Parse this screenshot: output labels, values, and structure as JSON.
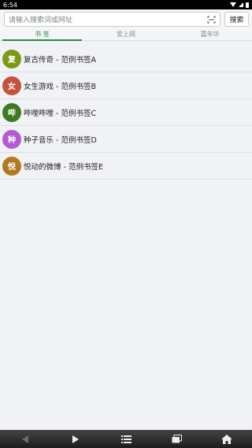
{
  "status_bar": {
    "time": "6:54"
  },
  "search": {
    "placeholder": "请输入搜索词或网址",
    "button_label": "搜索"
  },
  "tabs": [
    {
      "label": "书 签",
      "active": true
    },
    {
      "label": "爱上网",
      "active": false
    },
    {
      "label": "嘉年华",
      "active": false
    }
  ],
  "bookmarks": [
    {
      "avatar": "复",
      "color": "#7d9a16",
      "label": "复古传奇 - 范例书签A"
    },
    {
      "avatar": "女",
      "color": "#c4533b",
      "label": "女生游戏 - 范例书签B"
    },
    {
      "avatar": "哔",
      "color": "#3f7a22",
      "label": "哔哩哔哩 - 范例书签C"
    },
    {
      "avatar": "种",
      "color": "#b35bd1",
      "label": "种子音乐 - 范例书签D"
    },
    {
      "avatar": "悦",
      "color": "#b07a1f",
      "label": "悦动的微博 - 范例书签E"
    }
  ],
  "bottom_nav": {
    "icons": [
      "back-icon",
      "forward-icon",
      "menu-icon",
      "tabs-icon",
      "home-icon"
    ]
  }
}
